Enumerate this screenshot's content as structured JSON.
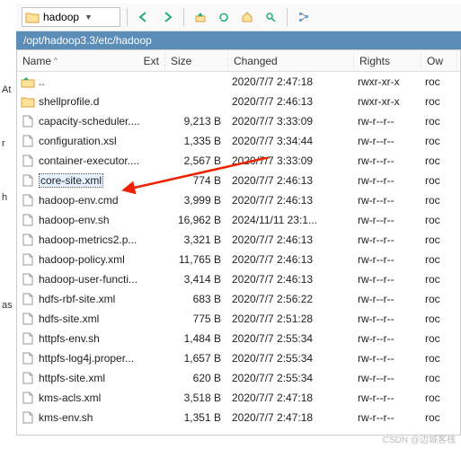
{
  "toolbar": {
    "current_folder": "hadoop"
  },
  "path": "/opt/hadoop3.3/etc/hadoop",
  "side": [
    "At",
    "r",
    "",
    "h",
    "",
    "",
    "",
    "",
    "",
    "as"
  ],
  "columns": {
    "name": "Name",
    "ext": "Ext",
    "size": "Size",
    "changed": "Changed",
    "rights": "Rights",
    "ow": "Ow"
  },
  "files": [
    {
      "icon": "up",
      "name": "..",
      "size": "",
      "changed": "2020/7/7 2:47:18",
      "rights": "rwxr-xr-x",
      "ow": "roc"
    },
    {
      "icon": "folder",
      "name": "shellprofile.d",
      "size": "",
      "changed": "2020/7/7 2:46:13",
      "rights": "rwxr-xr-x",
      "ow": "roc"
    },
    {
      "icon": "file",
      "name": "capacity-scheduler....",
      "size": "9,213 B",
      "changed": "2020/7/7 3:33:09",
      "rights": "rw-r--r--",
      "ow": "roc"
    },
    {
      "icon": "file",
      "name": "configuration.xsl",
      "size": "1,335 B",
      "changed": "2020/7/7 3:34:44",
      "rights": "rw-r--r--",
      "ow": "roc"
    },
    {
      "icon": "file",
      "name": "container-executor....",
      "size": "2,567 B",
      "changed": "2020/7/7 3:33:09",
      "rights": "rw-r--r--",
      "ow": "roc"
    },
    {
      "icon": "file",
      "name": "core-site.xml",
      "size": "774 B",
      "changed": "2020/7/7 2:46:13",
      "rights": "rw-r--r--",
      "ow": "roc",
      "selected": true
    },
    {
      "icon": "file",
      "name": "hadoop-env.cmd",
      "size": "3,999 B",
      "changed": "2020/7/7 2:46:13",
      "rights": "rw-r--r--",
      "ow": "roc"
    },
    {
      "icon": "file",
      "name": "hadoop-env.sh",
      "size": "16,962 B",
      "changed": "2024/11/11 23:1...",
      "rights": "rw-r--r--",
      "ow": "roc"
    },
    {
      "icon": "file",
      "name": "hadoop-metrics2.p...",
      "size": "3,321 B",
      "changed": "2020/7/7 2:46:13",
      "rights": "rw-r--r--",
      "ow": "roc"
    },
    {
      "icon": "file",
      "name": "hadoop-policy.xml",
      "size": "11,765 B",
      "changed": "2020/7/7 2:46:13",
      "rights": "rw-r--r--",
      "ow": "roc"
    },
    {
      "icon": "file",
      "name": "hadoop-user-functi...",
      "size": "3,414 B",
      "changed": "2020/7/7 2:46:13",
      "rights": "rw-r--r--",
      "ow": "roc"
    },
    {
      "icon": "file",
      "name": "hdfs-rbf-site.xml",
      "size": "683 B",
      "changed": "2020/7/7 2:56:22",
      "rights": "rw-r--r--",
      "ow": "roc"
    },
    {
      "icon": "file",
      "name": "hdfs-site.xml",
      "size": "775 B",
      "changed": "2020/7/7 2:51:28",
      "rights": "rw-r--r--",
      "ow": "roc"
    },
    {
      "icon": "file",
      "name": "httpfs-env.sh",
      "size": "1,484 B",
      "changed": "2020/7/7 2:55:34",
      "rights": "rw-r--r--",
      "ow": "roc"
    },
    {
      "icon": "file",
      "name": "httpfs-log4j.proper...",
      "size": "1,657 B",
      "changed": "2020/7/7 2:55:34",
      "rights": "rw-r--r--",
      "ow": "roc"
    },
    {
      "icon": "file",
      "name": "httpfs-site.xml",
      "size": "620 B",
      "changed": "2020/7/7 2:55:34",
      "rights": "rw-r--r--",
      "ow": "roc"
    },
    {
      "icon": "file",
      "name": "kms-acls.xml",
      "size": "3,518 B",
      "changed": "2020/7/7 2:47:18",
      "rights": "rw-r--r--",
      "ow": "roc"
    },
    {
      "icon": "file",
      "name": "kms-env.sh",
      "size": "1,351 B",
      "changed": "2020/7/7 2:47:18",
      "rights": "rw-r--r--",
      "ow": "roc"
    }
  ],
  "watermark": "CSDN @边城客栈"
}
